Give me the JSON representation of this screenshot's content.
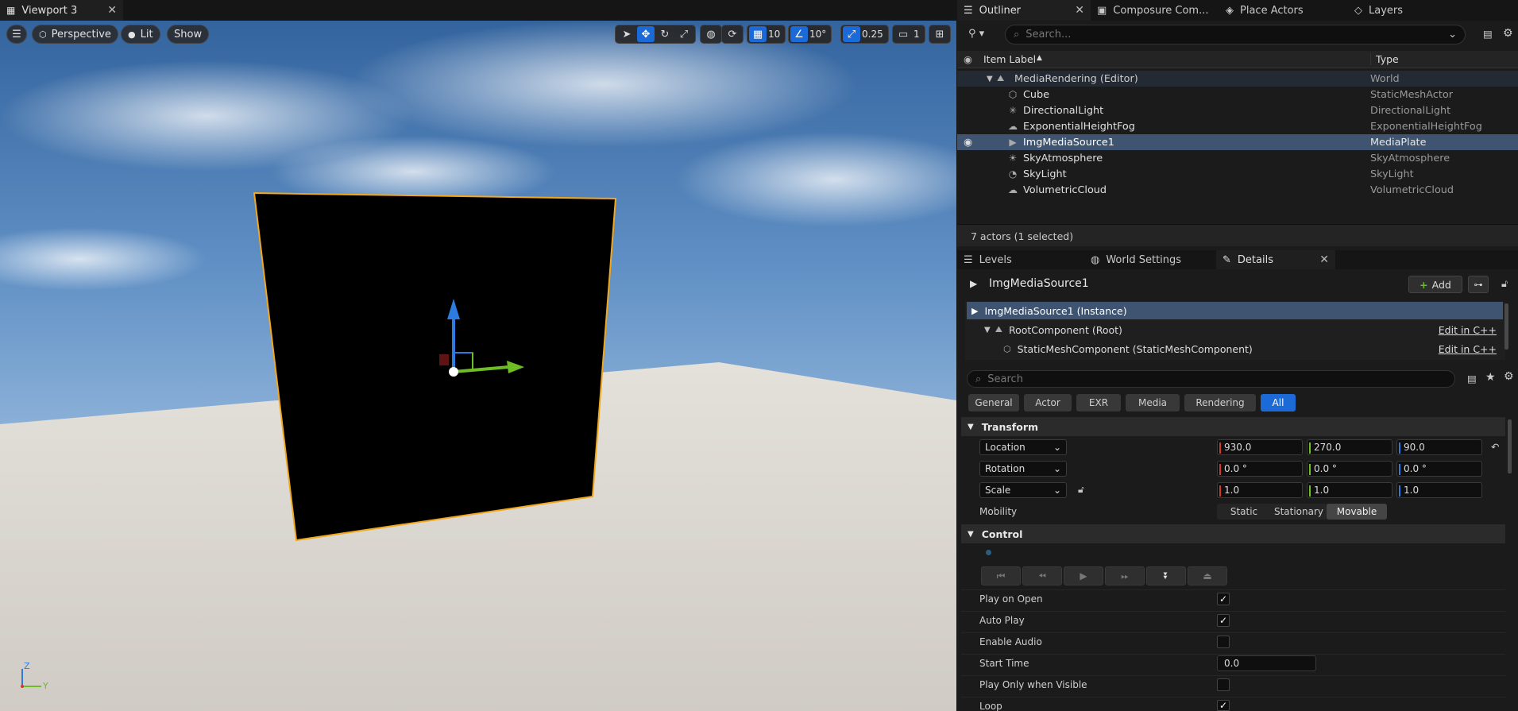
{
  "viewport": {
    "tab_title": "Viewport 3",
    "perspective_label": "Perspective",
    "lit_label": "Lit",
    "show_label": "Show",
    "grid_snap": "10",
    "rotation_snap": "10°",
    "scale_snap": "0.25",
    "camera_speed": "1",
    "axis_labels": {
      "z": "Z",
      "y": "Y"
    }
  },
  "outliner": {
    "tabs": [
      "Outliner",
      "Composure Com...",
      "Place Actors",
      "Layers"
    ],
    "search_placeholder": "Search...",
    "col_label": "Item Label",
    "col_type": "Type",
    "root": {
      "label": "MediaRendering (Editor)",
      "type": "World"
    },
    "items": [
      {
        "label": "Cube",
        "type": "StaticMeshActor",
        "icon": "cube-icon",
        "glyph": "⬡"
      },
      {
        "label": "DirectionalLight",
        "type": "DirectionalLight",
        "icon": "sun-icon",
        "glyph": "✳"
      },
      {
        "label": "ExponentialHeightFog",
        "type": "ExponentialHeightFog",
        "icon": "fog-icon",
        "glyph": "☁"
      },
      {
        "label": "ImgMediaSource1",
        "type": "MediaPlate",
        "icon": "media-plate-icon",
        "glyph": "▶"
      },
      {
        "label": "SkyAtmosphere",
        "type": "SkyAtmosphere",
        "icon": "sky-atmosphere-icon",
        "glyph": "☀"
      },
      {
        "label": "SkyLight",
        "type": "SkyLight",
        "icon": "skylight-icon",
        "glyph": "◔"
      },
      {
        "label": "VolumetricCloud",
        "type": "VolumetricCloud",
        "icon": "cloud-icon",
        "glyph": "☁"
      }
    ],
    "status": "7 actors (1 selected)"
  },
  "details_tabs": [
    "Levels",
    "World Settings",
    "Details"
  ],
  "details": {
    "actor_name": "ImgMediaSource1",
    "add_label": "Add",
    "components": [
      {
        "label": "ImgMediaSource1 (Instance)",
        "edit": ""
      },
      {
        "label": "RootComponent (Root)",
        "edit": "Edit in C++"
      },
      {
        "label": "StaticMeshComponent (StaticMeshComponent)",
        "edit": "Edit in C++"
      }
    ],
    "search_placeholder": "Search",
    "filters": [
      "General",
      "Actor",
      "EXR",
      "Media",
      "Rendering",
      "All"
    ],
    "transform": {
      "title": "Transform",
      "location": {
        "label": "Location",
        "x": "930.0",
        "y": "270.0",
        "z": "90.0"
      },
      "rotation": {
        "label": "Rotation",
        "x": "0.0 °",
        "y": "0.0 °",
        "z": "0.0 °"
      },
      "scale": {
        "label": "Scale",
        "x": "1.0",
        "y": "1.0",
        "z": "1.0"
      },
      "mobility_label": "Mobility",
      "mobility_options": [
        "Static",
        "Stationary",
        "Movable"
      ],
      "mobility_selected": "Movable"
    },
    "control": {
      "title": "Control",
      "play_on_open": {
        "label": "Play on Open",
        "checked": true
      },
      "auto_play": {
        "label": "Auto Play",
        "checked": true
      },
      "enable_audio": {
        "label": "Enable Audio",
        "checked": false
      },
      "start_time": {
        "label": "Start Time",
        "value": "0.0"
      },
      "play_only_visible": {
        "label": "Play Only when Visible",
        "checked": false
      },
      "loop": {
        "label": "Loop",
        "checked": true
      }
    }
  },
  "colors": {
    "accent": "#1b6ad8",
    "selection": "#3e5470",
    "x_axis": "#d23a2a",
    "y_axis": "#6fbd24",
    "z_axis": "#2e7be0",
    "outline": "#f2a81c"
  }
}
